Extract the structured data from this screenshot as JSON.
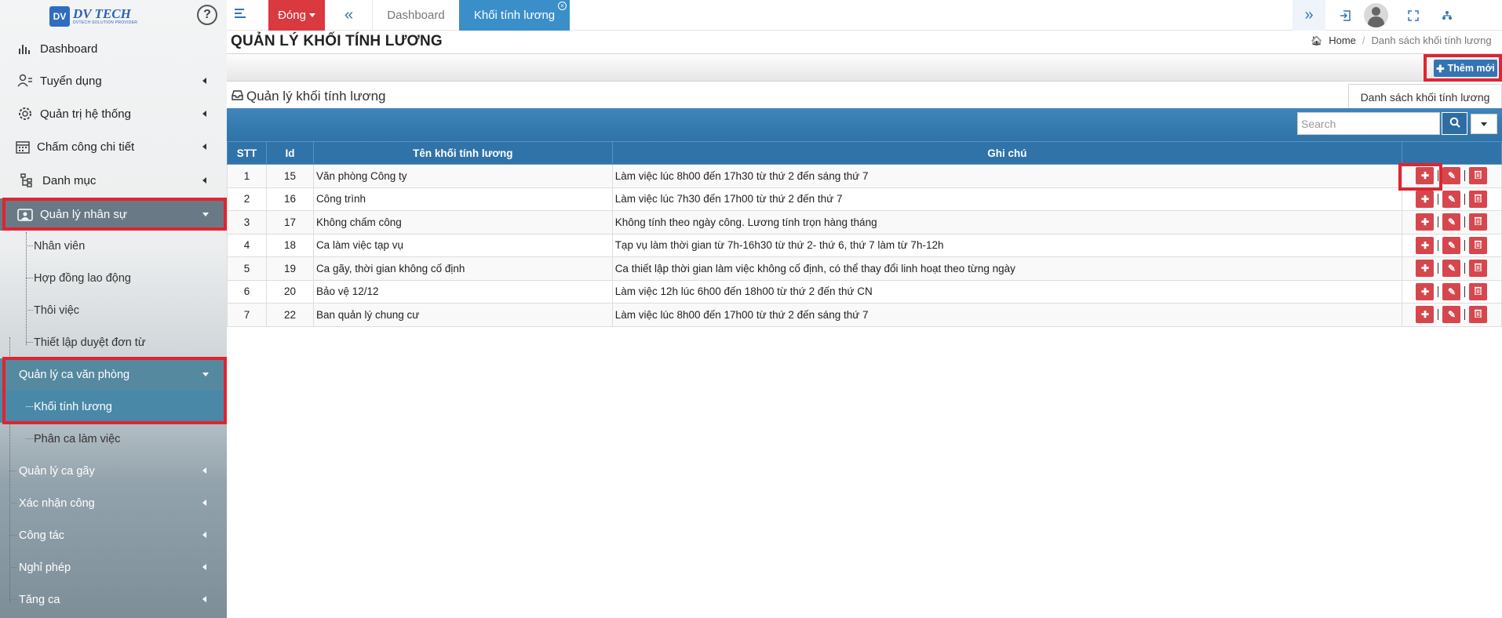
{
  "sidebar": {
    "logo_badge": "DV",
    "logo_main": "DV TECH",
    "logo_sub": "DVTECH SOLUTION PROVIDER",
    "help": "?",
    "menu": [
      {
        "label": "Dashboard",
        "icon": "bar-chart-icon"
      },
      {
        "label": "Tuyển dụng",
        "icon": "user-list-icon"
      },
      {
        "label": "Quản trị hệ thống",
        "icon": "gear-icon"
      },
      {
        "label": "Chấm công chi tiết",
        "icon": "calendar-icon"
      },
      {
        "label": "Danh mục",
        "icon": "tree-icon"
      },
      {
        "label": "Quản lý nhân sự",
        "icon": "id-card-icon"
      }
    ],
    "hr_sub": [
      "Nhân viên",
      "Hợp đồng lao động",
      "Thôi việc",
      "Thiết lập duyệt đơn từ"
    ],
    "office_shift": {
      "label": "Quản lý ca văn phòng",
      "children": [
        "Khối tính lương",
        "Phân ca làm việc"
      ]
    },
    "lower": [
      "Quản lý ca gãy",
      "Xác nhận công",
      "Công tác",
      "Nghỉ phép",
      "Tăng ca"
    ]
  },
  "topbar": {
    "close_label": "Đóng",
    "tabs": [
      "Dashboard",
      "Khối tính lương"
    ],
    "tab_close": "×"
  },
  "page": {
    "title": "QUẢN LÝ KHỐI TÍNH LƯƠNG",
    "breadcrumb_home": "Home",
    "breadcrumb_current": "Danh sách khối tính lương",
    "add_button": "Thêm mới",
    "panel_title": "Quản lý khối tính lương",
    "panel_tab": "Danh sách khối tính lương",
    "search_placeholder": "Search"
  },
  "table": {
    "headers": [
      "STT",
      "Id",
      "Tên khối tính lương",
      "Ghi chú",
      ""
    ],
    "rows": [
      [
        "1",
        "15",
        "Văn phòng Công ty",
        "Làm việc lúc 8h00 đến 17h30 từ thứ 2 đến sáng thứ 7"
      ],
      [
        "2",
        "16",
        "Công trình",
        "Làm việc lúc 7h30 đến 17h00 từ thứ 2 đến thứ 7"
      ],
      [
        "3",
        "17",
        "Không chấm công",
        "Không tính theo ngày công. Lương tính trọn hàng tháng"
      ],
      [
        "4",
        "18",
        "Ca làm việc tạp vụ",
        "Tạp vụ làm thời gian từ 7h-16h30 từ thứ 2- thứ 6, thứ 7 làm từ 7h-12h"
      ],
      [
        "5",
        "19",
        "Ca gãy, thời gian không cố định",
        "Ca thiết lập thời gian làm việc không cố định, có thể thay đổi linh hoạt theo từng ngày"
      ],
      [
        "6",
        "20",
        "Bảo vệ 12/12",
        "Làm việc 12h lúc 6h00 đến 18h00 từ thứ 2 đến thứ CN"
      ],
      [
        "7",
        "22",
        "Ban quản lý chung cư",
        "Làm việc lúc 8h00 đến 17h00 từ thứ 2 đến sáng thứ 7"
      ]
    ]
  },
  "colors": {
    "accent": "#3474b4",
    "danger": "#d6474d",
    "highlight": "#e02431"
  }
}
